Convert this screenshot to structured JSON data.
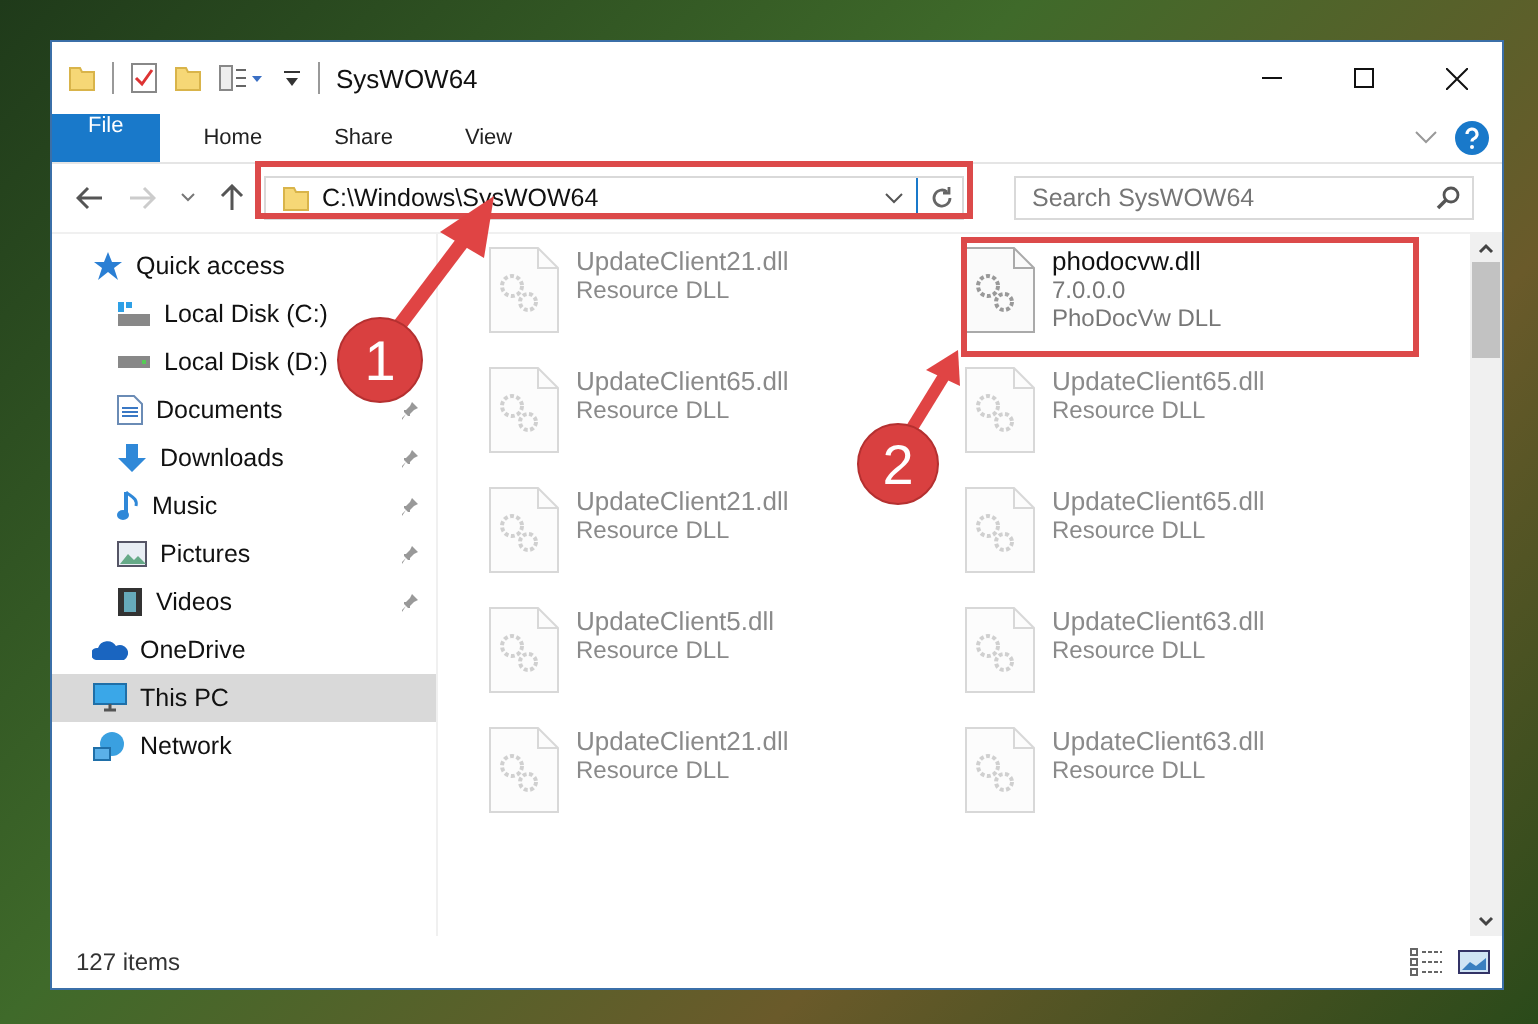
{
  "window": {
    "title": "SysWOW64"
  },
  "ribbon_tabs": [
    {
      "label": "File",
      "kind": "file-menu",
      "selected": false
    },
    {
      "label": "Home",
      "kind": "tab",
      "selected": false
    },
    {
      "label": "Share",
      "kind": "tab",
      "selected": false
    },
    {
      "label": "View",
      "kind": "tab",
      "selected": false
    }
  ],
  "address": {
    "path": "C:\\Windows\\SysWOW64"
  },
  "search": {
    "placeholder": "Search SysWOW64"
  },
  "nav": [
    {
      "label": "Quick access",
      "kind": "star",
      "selected": false,
      "children": [
        {
          "label": "Local Disk (C:)",
          "kind": "disk-c",
          "selected": false
        },
        {
          "label": "Local Disk (D:)",
          "kind": "disk",
          "selected": false
        },
        {
          "label": "Documents",
          "kind": "documents",
          "pinned": true,
          "selected": false
        },
        {
          "label": "Downloads",
          "kind": "downloads",
          "pinned": true,
          "selected": false
        },
        {
          "label": "Music",
          "kind": "music",
          "pinned": true,
          "selected": false
        },
        {
          "label": "Pictures",
          "kind": "pictures",
          "pinned": true,
          "selected": false
        },
        {
          "label": "Videos",
          "kind": "videos",
          "pinned": true,
          "selected": false
        }
      ]
    },
    {
      "label": "OneDrive",
      "kind": "cloud",
      "selected": false
    },
    {
      "label": "This PC",
      "kind": "pc",
      "selected": true
    },
    {
      "label": "Network",
      "kind": "network",
      "selected": false
    }
  ],
  "files": [
    {
      "name": "UpdateClient21.dll",
      "detail": "Resource DLL",
      "blurred": true
    },
    {
      "name": "phodocvw.dll",
      "version": "7.0.0.0",
      "detail": "PhoDocVw DLL",
      "blurred": false
    },
    {
      "name": "UpdateClient65.dll",
      "detail": "Resource DLL",
      "blurred": true
    },
    {
      "name": "UpdateClient65.dll",
      "detail": "Resource DLL",
      "blurred": true
    },
    {
      "name": "UpdateClient21.dll",
      "detail": "Resource DLL",
      "blurred": true
    },
    {
      "name": "UpdateClient65.dll",
      "detail": "Resource DLL",
      "blurred": true
    },
    {
      "name": "UpdateClient5.dll",
      "detail": "Resource DLL",
      "blurred": true
    },
    {
      "name": "UpdateClient63.dll",
      "detail": "Resource DLL",
      "blurred": true
    },
    {
      "name": "UpdateClient21.dll",
      "detail": "Resource DLL",
      "blurred": true
    },
    {
      "name": "UpdateClient63.dll",
      "detail": "Resource DLL",
      "blurred": true
    }
  ],
  "status_bar": {
    "count": "127 items"
  },
  "annotations": [
    {
      "number": "1"
    },
    {
      "number": "2"
    }
  ]
}
